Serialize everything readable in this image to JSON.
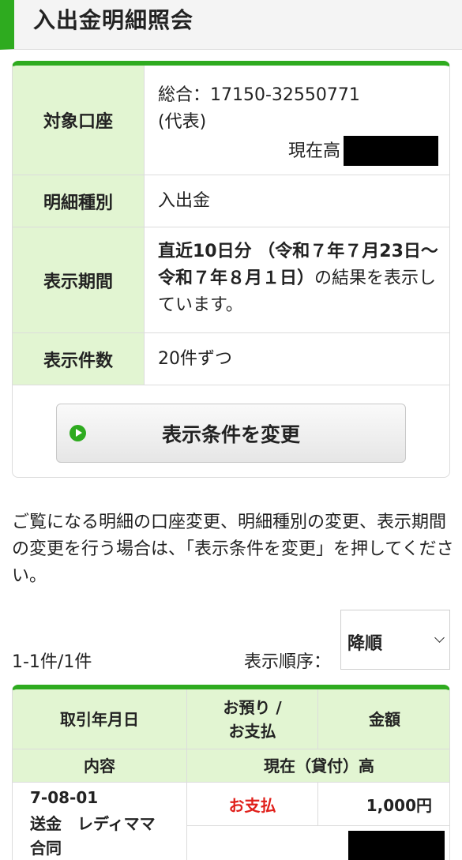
{
  "header": {
    "title": "入出金明細照会"
  },
  "info": {
    "account": {
      "label": "対象口座",
      "line1": "総合：17150-32550771",
      "line2": "(代表)",
      "balance_label": "現在高"
    },
    "type": {
      "label": "明細種別",
      "value": "入出金"
    },
    "period": {
      "label": "表示期間",
      "bold_text": "直近10日分 （令和７年７月23日～令和７年８月１日）",
      "suffix_text": "の結果を表示しています。"
    },
    "count": {
      "label": "表示件数",
      "value": "20件ずつ"
    },
    "change_button": "表示条件を変更"
  },
  "notice": "ご覧になる明細の口座変更、明細種別の変更、表示期間の変更を行う場合は、「表示条件を変更」を押してください。",
  "results": {
    "count_text": "1-1件/1件",
    "order_label": "表示順序：",
    "order_value": "降順"
  },
  "table": {
    "headers": {
      "date": "取引年月日",
      "kind_line1": "お預り /",
      "kind_line2": "お支払",
      "amount": "金額",
      "content": "内容",
      "balance": "現在（貸付）高"
    },
    "rows": [
      {
        "date": "7-08-01",
        "description": "送金　レディママ　合同",
        "kind": "お支払",
        "amount": "1,000円"
      }
    ]
  },
  "colors": {
    "accent": "#2eab1f",
    "label_bg": "#e2f5d2",
    "payment_red": "#e0201b"
  }
}
